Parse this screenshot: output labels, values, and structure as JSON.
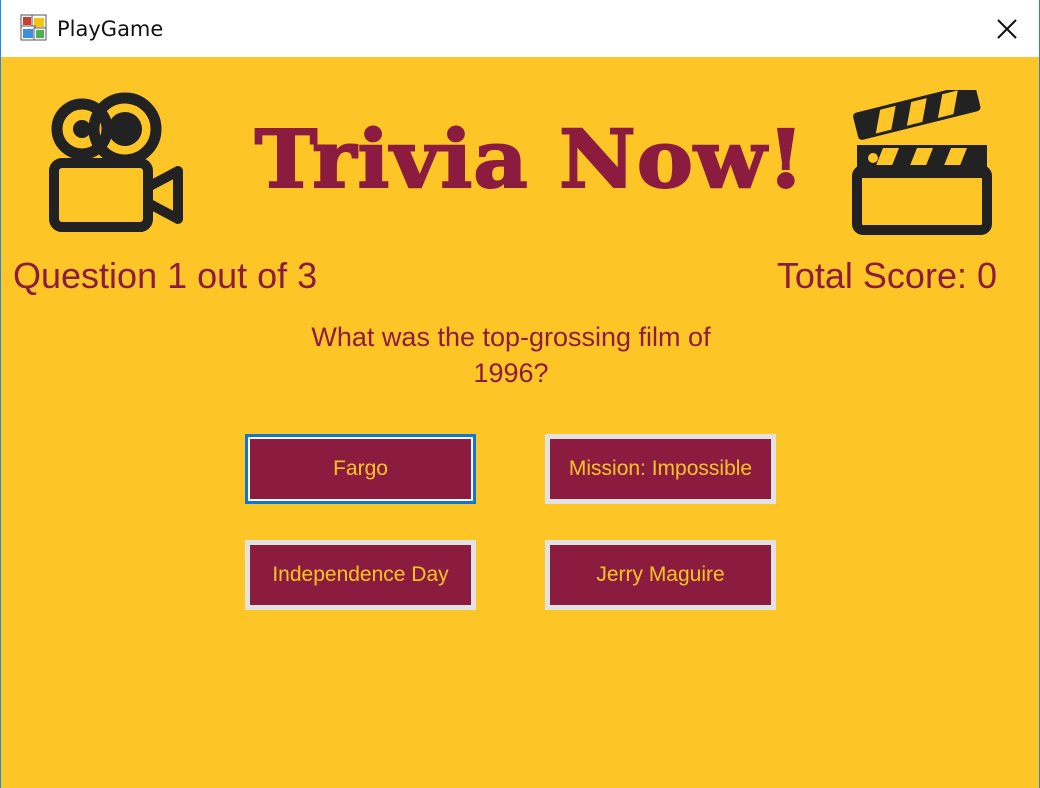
{
  "window": {
    "title": "PlayGame",
    "close_icon": "close-icon",
    "app_icon": "form-app-icon"
  },
  "game": {
    "title": "Trivia Now!",
    "question_counter": "Question 1 out of 3",
    "score": "Total Score: 0",
    "question": "What was the top-grossing film of 1996?",
    "answers": [
      "Fargo",
      "Mission: Impossible",
      "Independence Day",
      "Jerry Maguire"
    ],
    "focused_answer": "Fargo"
  },
  "icons": {
    "left": "movie-camera-icon",
    "right": "clapperboard-icon"
  },
  "colors": {
    "background": "#fdc526",
    "accent": "#8b1c3f",
    "button_text": "#fdc526",
    "focus_border": "#0a78d7",
    "window_border": "#1e88e5"
  }
}
